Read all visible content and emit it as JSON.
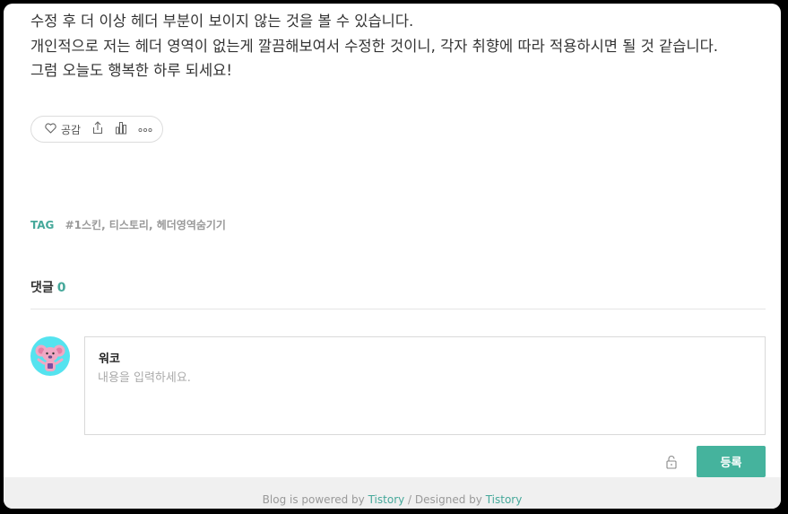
{
  "post": {
    "lines": [
      "수정 후 더 이상 헤더 부분이 보이지 않는 것을 볼 수 있습니다.",
      "개인적으로 저는 헤더 영역이 없는게 깔끔해보여서 수정한 것이니, 각자 취향에 따라 적용하시면 될 것 같습니다.",
      "그럼 오늘도 행복한 하루 되세요!"
    ]
  },
  "reactions": {
    "like_label": "공감",
    "icons": [
      "heart-icon",
      "share-icon",
      "stats-icon",
      "more-icon"
    ]
  },
  "tags": {
    "label": "TAG",
    "list": "#1스킨, 티스토리, 헤더영역숨기기"
  },
  "comments": {
    "heading": "댓글",
    "count": "0",
    "writer_name": "워코",
    "placeholder": "내용을 입력하세요.",
    "submit_label": "등록",
    "lock_icon": "lock-icon",
    "avatar_icon": "koala-avatar"
  },
  "footer": {
    "prefix": "Blog is powered by ",
    "link1": "Tistory",
    "separator": " / Designed by ",
    "link2": "Tistory"
  },
  "colors": {
    "accent": "#45b39d",
    "tag_label": "#45a89a",
    "avatar_bg": "#55e3ef"
  }
}
